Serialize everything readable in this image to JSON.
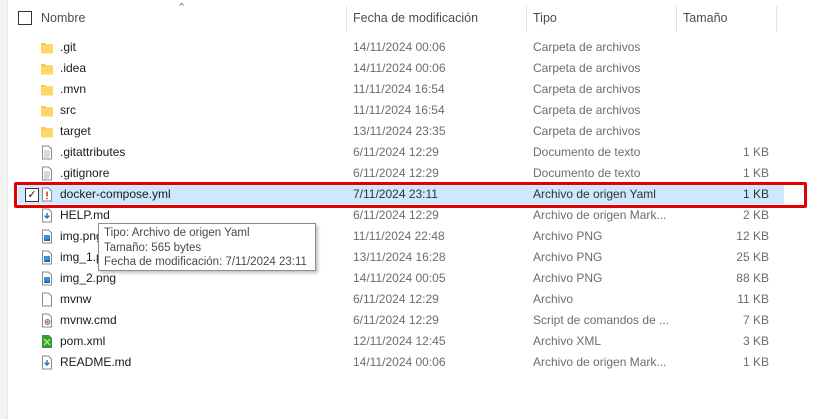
{
  "header": {
    "name": "Nombre",
    "date": "Fecha de modificación",
    "type": "Tipo",
    "size": "Tamaño"
  },
  "files": [
    {
      "name": ".git",
      "date": "14/11/2024 00:06",
      "type": "Carpeta de archivos",
      "size": "",
      "icon": "folder-icon"
    },
    {
      "name": ".idea",
      "date": "14/11/2024 00:06",
      "type": "Carpeta de archivos",
      "size": "",
      "icon": "folder-icon"
    },
    {
      "name": ".mvn",
      "date": "11/11/2024 16:54",
      "type": "Carpeta de archivos",
      "size": "",
      "icon": "folder-icon"
    },
    {
      "name": "src",
      "date": "11/11/2024 16:54",
      "type": "Carpeta de archivos",
      "size": "",
      "icon": "folder-icon"
    },
    {
      "name": "target",
      "date": "13/11/2024 23:35",
      "type": "Carpeta de archivos",
      "size": "",
      "icon": "folder-icon"
    },
    {
      "name": ".gitattributes",
      "date": "6/11/2024 12:29",
      "type": "Documento de texto",
      "size": "1 KB",
      "icon": "text-file-icon"
    },
    {
      "name": ".gitignore",
      "date": "6/11/2024 12:29",
      "type": "Documento de texto",
      "size": "1 KB",
      "icon": "text-file-icon"
    },
    {
      "name": "docker-compose.yml",
      "date": "7/11/2024 23:11",
      "type": "Archivo de origen Yaml",
      "size": "1 KB",
      "icon": "yaml-file-icon",
      "selected": true
    },
    {
      "name": "HELP.md",
      "date": "6/11/2024 12:29",
      "type": "Archivo de origen Mark...",
      "size": "2 KB",
      "icon": "markdown-file-icon"
    },
    {
      "name": "img.png",
      "date": "11/11/2024 22:48",
      "type": "Archivo PNG",
      "size": "12 KB",
      "icon": "image-file-icon"
    },
    {
      "name": "img_1.png",
      "date": "13/11/2024 16:28",
      "type": "Archivo PNG",
      "size": "25 KB",
      "icon": "image-file-icon"
    },
    {
      "name": "img_2.png",
      "date": "14/11/2024 00:05",
      "type": "Archivo PNG",
      "size": "88 KB",
      "icon": "image-file-icon"
    },
    {
      "name": "mvnw",
      "date": "6/11/2024 12:29",
      "type": "Archivo",
      "size": "11 KB",
      "icon": "blank-file-icon"
    },
    {
      "name": "mvnw.cmd",
      "date": "6/11/2024 12:29",
      "type": "Script de comandos de ...",
      "size": "7 KB",
      "icon": "cmd-file-icon"
    },
    {
      "name": "pom.xml",
      "date": "12/11/2024 12:45",
      "type": "Archivo XML",
      "size": "3 KB",
      "icon": "xml-file-icon"
    },
    {
      "name": "README.md",
      "date": "14/11/2024 00:06",
      "type": "Archivo de origen Mark...",
      "size": "1 KB",
      "icon": "markdown-file-icon"
    }
  ],
  "tooltip": {
    "line1": "Tipo: Archivo de origen Yaml",
    "line2": "Tamaño: 565 bytes",
    "line3": "Fecha de modificación: 7/11/2024 23:11"
  },
  "colors": {
    "selection": "#cde8ff",
    "highlight_border": "#e00000",
    "folder": "#f7c64c"
  }
}
